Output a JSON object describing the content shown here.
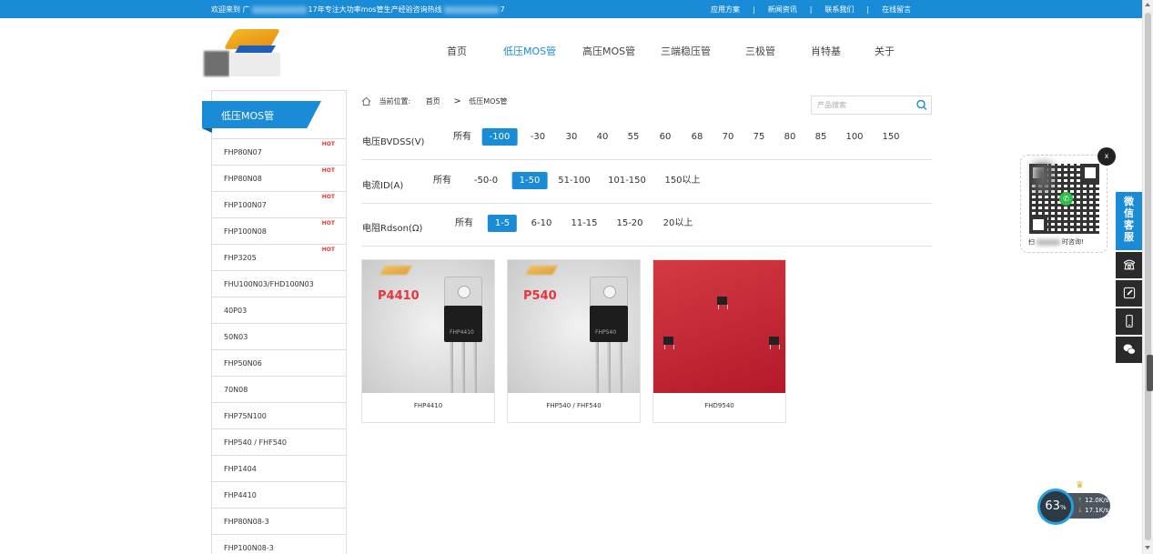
{
  "topbar": {
    "welcome_pre": "欢迎来到 广",
    "welcome_post": "17年专注大功率mos管生产经验咨询热线",
    "welcome_tail": "7",
    "links": [
      "应用方案",
      "新闻资讯",
      "联系我们",
      "在线留言"
    ]
  },
  "nav": {
    "items": [
      "首页",
      "低压MOS管",
      "高压MOS管",
      "三端稳压管",
      "三极管",
      "肖特基",
      "关于"
    ],
    "active_index": 1
  },
  "sidebar": {
    "title": "低压MOS管",
    "hot_label": "HOT",
    "items": [
      {
        "label": "FHP80N07",
        "hot": true
      },
      {
        "label": "FHP80N08",
        "hot": true
      },
      {
        "label": "FHP100N07",
        "hot": true
      },
      {
        "label": "FHP100N08",
        "hot": true
      },
      {
        "label": "FHP3205",
        "hot": true
      },
      {
        "label": "FHU100N03/FHD100N03",
        "hot": false
      },
      {
        "label": "40P03",
        "hot": false
      },
      {
        "label": "50N03",
        "hot": false
      },
      {
        "label": "FHP50N06",
        "hot": false
      },
      {
        "label": "70N08",
        "hot": false
      },
      {
        "label": "FHP75N100",
        "hot": false
      },
      {
        "label": "FHP540 / FHF540",
        "hot": false
      },
      {
        "label": "FHP1404",
        "hot": false
      },
      {
        "label": "FHP4410",
        "hot": false
      },
      {
        "label": "FHP80N08-3",
        "hot": false
      },
      {
        "label": "FHP100N08-3",
        "hot": false
      }
    ]
  },
  "breadcrumb": {
    "prefix": "当前位置:",
    "home": "首页",
    "separator": ">",
    "current": "低压MOS管"
  },
  "search": {
    "placeholder": "产品搜索"
  },
  "filters": [
    {
      "label": "电压BVDSS(V)",
      "options": [
        "所有",
        "-100",
        "-30",
        "30",
        "40",
        "55",
        "60",
        "68",
        "70",
        "75",
        "80",
        "85",
        "100",
        "150"
      ],
      "selected": 1
    },
    {
      "label": "电流ID(A)",
      "options": [
        "所有",
        "-50-0",
        "1-50",
        "51-100",
        "101-150",
        "150以上"
      ],
      "selected": 2
    },
    {
      "label": "电阻Rdson(Ω)",
      "options": [
        "所有",
        "1-5",
        "6-10",
        "11-15",
        "15-20",
        "20以上"
      ],
      "selected": 1
    }
  ],
  "products": [
    {
      "name": "FHP4410",
      "tag": "P4410",
      "marking": "FHP4410",
      "bg": "gray"
    },
    {
      "name": "FHP540 / FHF540",
      "tag": "P540",
      "marking": "FHP540",
      "bg": "gray"
    },
    {
      "name": "FHD9540",
      "tag": "",
      "marking": "",
      "bg": "red"
    }
  ],
  "float": {
    "close": "x",
    "scan_text_a": "扫",
    "scan_text_b": "时咨询!",
    "wechat_service": "微信客服",
    "icons": [
      "phone-icon",
      "edit-icon",
      "mobile-icon",
      "wechat-icon"
    ]
  },
  "speed": {
    "percent": "63",
    "percent_unit": "%",
    "up": "12.0K/s",
    "down": "17.1K/s"
  },
  "colors": {
    "primary": "#1a8bd6",
    "hot": "#e33333",
    "dark": "#2a2a2a"
  }
}
